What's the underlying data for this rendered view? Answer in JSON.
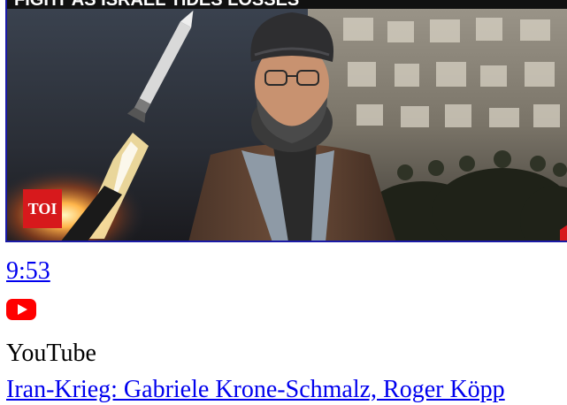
{
  "video": {
    "thumbnail": {
      "headline": "FIGHT AS ISRAEL TIDES LOSSES",
      "badge": "TOI"
    },
    "duration": "9:53",
    "source_icon": "youtube-play-icon",
    "source": "YouTube",
    "title": "Iran-Krieg: Gabriele Krone-Schmalz, Roger Köpp"
  },
  "colors": {
    "link": "#0000ee",
    "thumbnail_border": "#1a1aa6",
    "youtube_red": "#ff0000",
    "badge_red": "#d7191c"
  }
}
